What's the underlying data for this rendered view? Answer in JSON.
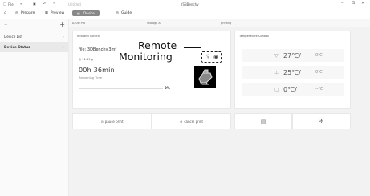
{
  "titlebar": {
    "file_label": "File",
    "doc_title": "Untitled",
    "app_title": "YSBBenchy"
  },
  "window_controls": {
    "minimize": "–",
    "maximize": "⊡",
    "close": "✕"
  },
  "menubar": {
    "prepare": "Prepare",
    "preview": "Preview",
    "device": "Device",
    "guide": "Guide"
  },
  "sidebar": {
    "add": "+",
    "items": [
      {
        "label": "Device List",
        "chevron": "›"
      },
      {
        "label": "Device Status",
        "chevron": "›"
      }
    ]
  },
  "infobar": {
    "printer": "A20M Pro",
    "storage": "Storage A",
    "state": "printing"
  },
  "info_card": {
    "title": "Info and Control",
    "file_name": "file: 3DBenchy.3mf",
    "weight": "11.89 g",
    "remaining_time": "00h 36min",
    "remaining_label": "Remaining Time",
    "progress_percent": 0,
    "progress_label": "0%"
  },
  "annotation": {
    "line1": "Remote",
    "line2": "Monitoring"
  },
  "temperature_card": {
    "title": "Temperature Control",
    "rows": [
      {
        "icon": "nozzle-icon",
        "glyph": "▽",
        "current": "27℃/",
        "target": "0℃"
      },
      {
        "icon": "bed-icon",
        "glyph": "⊥",
        "current": "25℃/",
        "target": "0℃"
      },
      {
        "icon": "chamber-icon",
        "glyph": "▢",
        "current": "0℃/",
        "target": "--℃"
      }
    ]
  },
  "controls": {
    "pause": "pause print",
    "cancel": "cancel print"
  }
}
